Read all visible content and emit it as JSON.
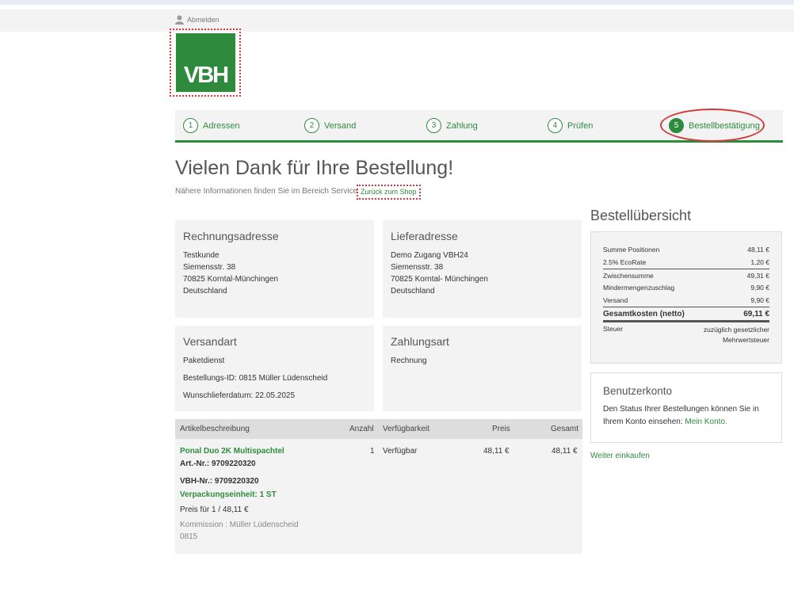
{
  "header": {
    "logout_label": "Abmelden",
    "logo_text": "VBH"
  },
  "steps": [
    {
      "num": "1",
      "label": "Adressen"
    },
    {
      "num": "2",
      "label": "Versand"
    },
    {
      "num": "3",
      "label": "Zahlung"
    },
    {
      "num": "4",
      "label": "Prüfen"
    },
    {
      "num": "5",
      "label": "Bestellbestätigung"
    }
  ],
  "main": {
    "title": "Vielen Dank für Ihre Bestellung!",
    "info_text": "Nähere Informationen finden Sie im Bereich Service",
    "back_link": "Zurück zum Shop"
  },
  "billing": {
    "title": "Rechnungsadresse",
    "lines": [
      "Testkunde",
      "Siemensstr. 38",
      "70825  Korntal-Münchingen",
      "Deutschland"
    ]
  },
  "delivery": {
    "title": "Lieferadresse",
    "lines": [
      "Demo Zugang VBH24",
      "Siemensstr. 38",
      "70825  Korntal- Münchingen",
      "Deutschland"
    ]
  },
  "shipping": {
    "title": "Versandart",
    "method": "Paketdienst",
    "order_id": "Bestellungs-ID:  0815 Müller Lüdenscheid",
    "desired_date": "Wunschlieferdatum:  22.05.2025"
  },
  "payment": {
    "title": "Zahlungsart",
    "method": "Rechnung"
  },
  "table": {
    "headers": {
      "desc": "Artikelbeschreibung",
      "qty": "Anzahl",
      "avail": "Verfügbarkeit",
      "price": "Preis",
      "total": "Gesamt"
    },
    "item": {
      "name": "Ponal Duo 2K Multispachtel",
      "art_nr": "Art.-Nr.: 9709220320",
      "vbh_nr": "VBH-Nr.: 9709220320",
      "pack_unit": "Verpackungseinheit: 1 ST",
      "price_for": "Preis für 1 / 48,11 €",
      "commission": "Kommission : Müller Lüdenscheid",
      "commission_code": "0815",
      "qty": "1",
      "availability": "Verfügbar",
      "price": "48,11 €",
      "total": "48,11 €"
    }
  },
  "summary": {
    "title": "Bestellübersicht",
    "rows": [
      {
        "label": "Summe Positionen",
        "value": "48,11 €"
      },
      {
        "label": "2.5% EcoRate",
        "value": "1,20 €"
      },
      {
        "label": "Zwischensumme",
        "value": "49,31 €"
      },
      {
        "label": "Mindermengenzuschlag",
        "value": "9,90 €"
      },
      {
        "label": "Versand",
        "value": "9,90 €"
      }
    ],
    "total_label": "Gesamtkosten (netto)",
    "total_value": "69,11 €",
    "tax_label": "Steuer",
    "tax_value_1": "zuzüglich gesetzlicher",
    "tax_value_2": "Mehrwertsteuer"
  },
  "account": {
    "title": "Benutzerkonto",
    "text": "Den Status Ihrer Bestellungen können Sie in Ihrem Konto einsehen:",
    "link": "Mein Konto."
  },
  "continue_label": "Weiter einkaufen"
}
